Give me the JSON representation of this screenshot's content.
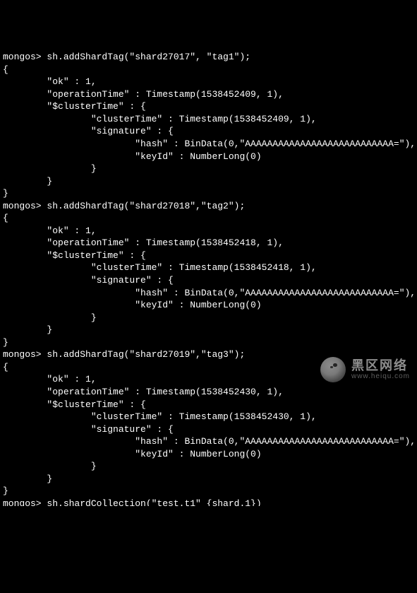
{
  "prompt": "mongos>",
  "blocks": [
    {
      "cmd": "sh.addShardTag(\"shard27017\", \"tag1\");",
      "ok": 1,
      "operationTime_ts": 1538452409,
      "operationTime_inc": 1,
      "clusterTime_ts": 1538452409,
      "clusterTime_inc": 1,
      "hash_type": "BinData",
      "hash_arg0": 0,
      "hash_arg1": "AAAAAAAAAAAAAAAAAAAAAAAAAAA=",
      "keyId_fn": "NumberLong",
      "keyId_val": 0
    },
    {
      "cmd": "sh.addShardTag(\"shard27018\",\"tag2\");",
      "ok": 1,
      "operationTime_ts": 1538452418,
      "operationTime_inc": 1,
      "clusterTime_ts": 1538452418,
      "clusterTime_inc": 1,
      "hash_type": "BinData",
      "hash_arg0": 0,
      "hash_arg1": "AAAAAAAAAAAAAAAAAAAAAAAAAAA=",
      "keyId_fn": "NumberLong",
      "keyId_val": 0
    },
    {
      "cmd": "sh.addShardTag(\"shard27019\",\"tag3\");",
      "ok": 1,
      "operationTime_ts": 1538452430,
      "operationTime_inc": 1,
      "clusterTime_ts": 1538452430,
      "clusterTime_inc": 1,
      "hash_type": "BinData",
      "hash_arg0": 0,
      "hash_arg1": "AAAAAAAAAAAAAAAAAAAAAAAAAAA=",
      "keyId_fn": "NumberLong",
      "keyId_val": 0
    }
  ],
  "trailing_cmd_partial": "sh.shardCollection(\"test.t1\" {shard.1})",
  "watermark": {
    "line1": "黑区网络",
    "line2": "www.heiqu.com"
  }
}
